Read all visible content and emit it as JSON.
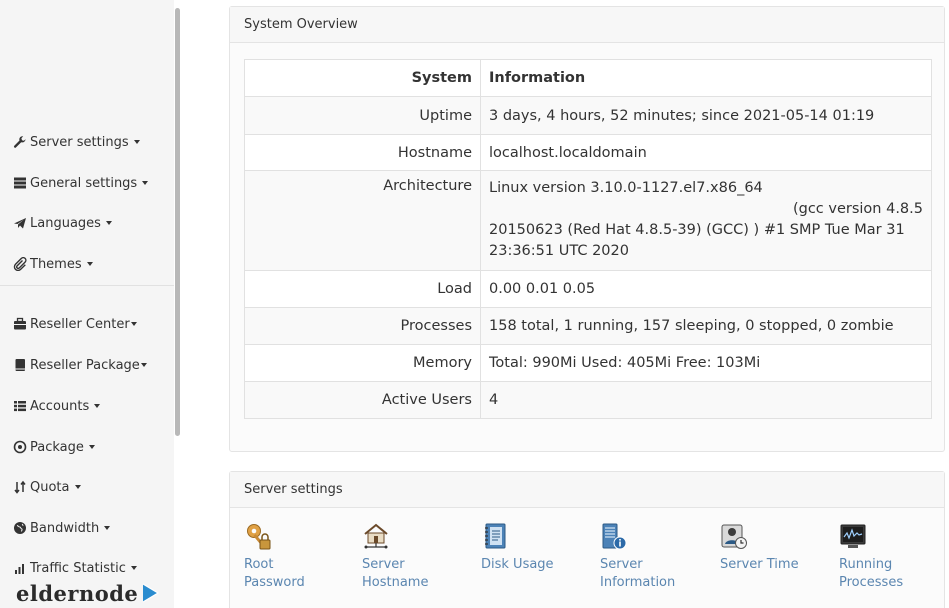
{
  "sidebar": {
    "items": [
      {
        "label": "Server settings",
        "icon": "wrench-icon"
      },
      {
        "label": "General settings",
        "icon": "server-icon"
      },
      {
        "label": "Languages",
        "icon": "paper-plane-icon"
      },
      {
        "label": "Themes",
        "icon": "paperclip-icon"
      },
      {
        "label": "Reseller Center",
        "icon": "briefcase-icon"
      },
      {
        "label": "Reseller Package",
        "icon": "book-icon"
      },
      {
        "label": "Accounts",
        "icon": "list-icon"
      },
      {
        "label": "Package",
        "icon": "target-icon"
      },
      {
        "label": "Quota",
        "icon": "sort-icon"
      },
      {
        "label": "Bandwidth",
        "icon": "globe-icon"
      },
      {
        "label": "Traffic Statistic",
        "icon": "bar-chart-icon"
      }
    ]
  },
  "logo": {
    "text": "eldernode"
  },
  "system_overview": {
    "title": "System Overview",
    "header": {
      "key": "System",
      "value": "Information"
    },
    "rows": [
      {
        "key": "Uptime",
        "value": "3 days, 4 hours, 52 minutes; since 2021-05-14 01:19"
      },
      {
        "key": "Hostname",
        "value": "localhost.localdomain"
      },
      {
        "key": "Architecture",
        "line1": "Linux version 3.10.0-1127.el7.x86_64",
        "line2": "(gcc version 4.8.5",
        "line3": "20150623 (Red Hat 4.8.5-39) (GCC) ) #1 SMP Tue Mar 31",
        "line4": "23:36:51 UTC 2020"
      },
      {
        "key": "Load",
        "value": "0.00 0.01 0.05"
      },
      {
        "key": "Processes",
        "value": "158 total, 1 running, 157 sleeping, 0 stopped, 0 zombie"
      },
      {
        "key": "Memory",
        "value": "Total: 990Mi Used: 405Mi Free: 103Mi"
      },
      {
        "key": "Active Users",
        "value": "4"
      }
    ]
  },
  "server_settings": {
    "title": "Server settings",
    "tools": [
      {
        "line1": "Root",
        "line2": "Password",
        "icon": "key-lock-icon"
      },
      {
        "line1": "Server",
        "line2": "Hostname",
        "icon": "house-network-icon"
      },
      {
        "line1": "Disk Usage",
        "line2": "",
        "icon": "notebook-icon"
      },
      {
        "line1": "Server",
        "line2": "Information",
        "icon": "server-info-icon"
      },
      {
        "line1": "Server Time",
        "line2": "",
        "icon": "user-clock-icon"
      },
      {
        "line1": "Running",
        "line2": "Processes",
        "icon": "monitor-graph-icon"
      }
    ]
  },
  "colors": {
    "link": "#5b86b0",
    "sidebar_bg": "#f5f5f5",
    "panel_border": "#e4e4e4"
  }
}
